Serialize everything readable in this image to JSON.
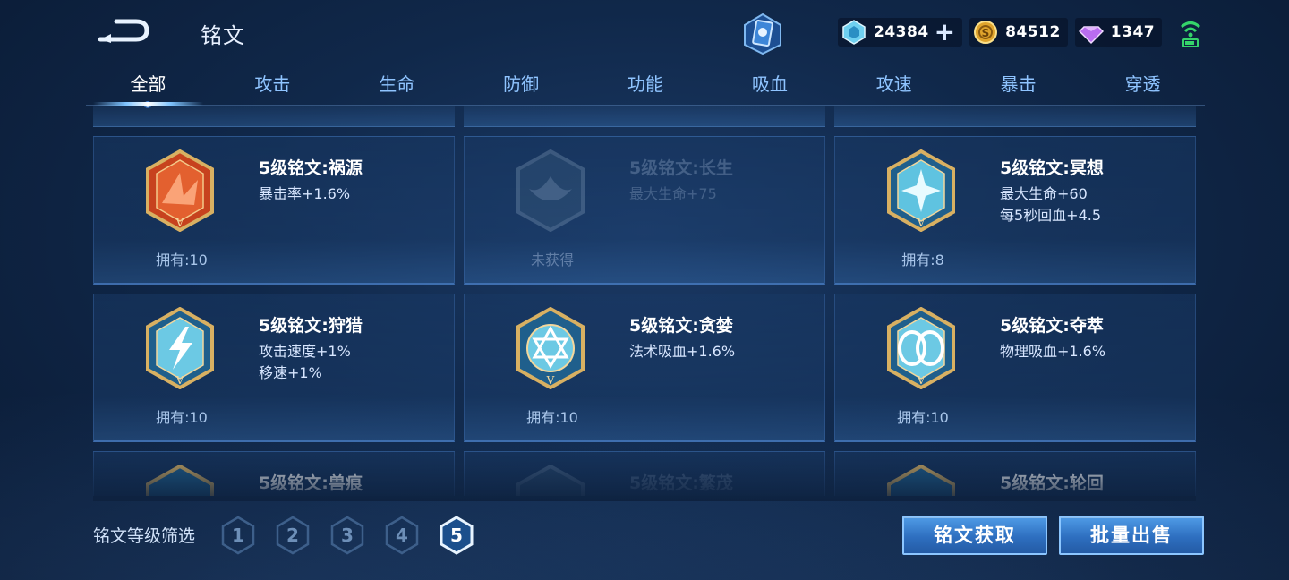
{
  "header": {
    "title": "铭文",
    "currencies": [
      {
        "name": "coupon",
        "icon": "crystal-icon",
        "value": "24384"
      },
      {
        "name": "gold",
        "icon": "gold-coin-icon",
        "value": "84512"
      },
      {
        "name": "diamond",
        "icon": "diamond-icon",
        "value": "1347"
      }
    ]
  },
  "tabs": [
    {
      "label": "全部",
      "active": true
    },
    {
      "label": "攻击"
    },
    {
      "label": "生命"
    },
    {
      "label": "防御"
    },
    {
      "label": "功能"
    },
    {
      "label": "吸血"
    },
    {
      "label": "攻速"
    },
    {
      "label": "暴击"
    },
    {
      "label": "穿透"
    }
  ],
  "cards": [
    {
      "name": "5级铭文:祸源",
      "stats": [
        "暴击率+1.6%"
      ],
      "owned": "拥有:10",
      "locked": false,
      "emblem": "red-emblem-icon"
    },
    {
      "name": "5级铭文:长生",
      "stats": [
        "最大生命+75"
      ],
      "owned": "未获得",
      "locked": true,
      "emblem": "whale-tail-emblem-icon"
    },
    {
      "name": "5级铭文:冥想",
      "stats": [
        "最大生命+60",
        "每5秒回血+4.5"
      ],
      "owned": "拥有:8",
      "locked": false,
      "emblem": "blue-star-emblem-icon"
    },
    {
      "name": "5级铭文:狩猎",
      "stats": [
        "攻击速度+1%",
        "移速+1%"
      ],
      "owned": "拥有:10",
      "locked": false,
      "emblem": "lightning-emblem-icon"
    },
    {
      "name": "5级铭文:贪婪",
      "stats": [
        "法术吸血+1.6%"
      ],
      "owned": "拥有:10",
      "locked": false,
      "emblem": "star-circle-emblem-icon"
    },
    {
      "name": "5级铭文:夺萃",
      "stats": [
        "物理吸血+1.6%"
      ],
      "owned": "拥有:10",
      "locked": false,
      "emblem": "knot-emblem-icon"
    },
    {
      "name": "5级铭文:兽痕",
      "stats": [],
      "owned": "",
      "locked": false,
      "emblem": "blue-emblem-icon"
    },
    {
      "name": "5级铭文:繁茂",
      "stats": [],
      "owned": "",
      "locked": true,
      "emblem": "faded-emblem-icon"
    },
    {
      "name": "5级铭文:轮回",
      "stats": [],
      "owned": "",
      "locked": false,
      "emblem": "blue-emblem-icon"
    }
  ],
  "filter": {
    "label": "铭文等级筛选",
    "levels": [
      "1",
      "2",
      "3",
      "4",
      "5"
    ],
    "active_level": "5"
  },
  "buttons": {
    "obtain": "铭文获取",
    "sell": "批量出售"
  },
  "colors": {
    "accent": "#8cc6ff",
    "button": "#2e6fc0",
    "background": "#10284a",
    "emblem_gold": "#d8b062",
    "emblem_red": "#c7421e",
    "emblem_blue": "#5fc3e0"
  }
}
